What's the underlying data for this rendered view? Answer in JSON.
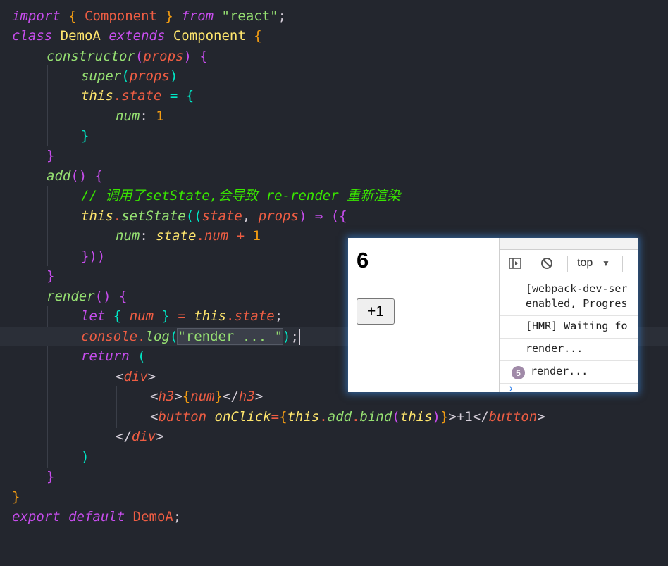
{
  "code": {
    "line1": {
      "kw": "import",
      "ob": "{",
      "name": "Component",
      "cb": "}",
      "from": "from",
      "src": "\"react\"",
      "semi": ";"
    },
    "line2": {
      "kw": "class",
      "name": "DemoA",
      "ext": "extends",
      "base": "Component",
      "ob": "{"
    },
    "line3": {
      "name": "constructor",
      "op": "(",
      "param": "props",
      "cp": ")",
      "ob": "{"
    },
    "line4": {
      "name": "super",
      "op": "(",
      "param": "props",
      "cp": ")"
    },
    "line5": {
      "this": "this",
      "dot": ".",
      "prop": "state",
      "eq": "=",
      "ob": "{"
    },
    "line6": {
      "key": "num",
      "colon": ":",
      "val": "1"
    },
    "line7": {
      "cb": "}"
    },
    "line8": {
      "cb": "}"
    },
    "line9": {
      "name": "add",
      "parens": "()",
      "ob": "{"
    },
    "line10": {
      "comment": "// 调用了setState,会导致 re-render 重新渲染"
    },
    "line11": {
      "this": "this",
      "dot": ".",
      "method": "setState",
      "op": "((",
      "p1": "state",
      "comma": ",",
      "p2": "props",
      "cp": ")",
      "arrow": "⇒",
      "ob": "({"
    },
    "line12": {
      "key": "num",
      "colon": ":",
      "obj": "state",
      "dot": ".",
      "prop": "num",
      "plus": "+",
      "val": "1"
    },
    "line13": {
      "close": "}))"
    },
    "line14": {
      "cb": "}"
    },
    "line15": {
      "name": "render",
      "parens": "()",
      "ob": "{"
    },
    "line16": {
      "kw": "let",
      "ob": "{",
      "var": "num",
      "cb": "}",
      "eq": "=",
      "this": "this",
      "dot": ".",
      "prop": "state",
      "semi": ";"
    },
    "line17": {
      "obj": "console",
      "dot": ".",
      "method": "log",
      "op": "(",
      "str": "\"render ... \"",
      "cp": ")",
      "semi": ";"
    },
    "line18": {
      "kw": "return",
      "op": "("
    },
    "line19": {
      "lt": "<",
      "tag": "div",
      "gt": ">"
    },
    "line20": {
      "lt": "<",
      "tag": "h3",
      "gt": ">",
      "ob": "{",
      "var": "num",
      "cb": "}",
      "lt2": "</",
      "tag2": "h3",
      "gt2": ">"
    },
    "line21": {
      "lt": "<",
      "tag": "button",
      "attr": "onClick",
      "eq": "=",
      "ob": "{",
      "this": "this",
      "dot": ".",
      "m1": "add",
      "dot2": ".",
      "m2": "bind",
      "op": "(",
      "this2": "this",
      "cp": ")",
      "cb": "}",
      "gt": ">",
      "text": "+1",
      "lt2": "</",
      "tag2": "button",
      "gt2": ">"
    },
    "line22": {
      "lt": "</",
      "tag": "div",
      "gt": ">"
    },
    "line23": {
      "cp": ")"
    },
    "line24": {
      "cb": "}"
    },
    "line25": {
      "cb": "}"
    },
    "line26": {
      "kw1": "export",
      "kw2": "default",
      "name": "DemoA",
      "semi": ";"
    }
  },
  "preview": {
    "counter": "6",
    "button_label": "+1"
  },
  "devtools": {
    "context": "top",
    "messages": [
      {
        "text": "[webpack-dev-ser\nenabled, Progres"
      },
      {
        "text": "[HMR] Waiting fo"
      },
      {
        "text": "render..."
      },
      {
        "count": "5",
        "text": "render..."
      }
    ],
    "prompt": "›"
  }
}
